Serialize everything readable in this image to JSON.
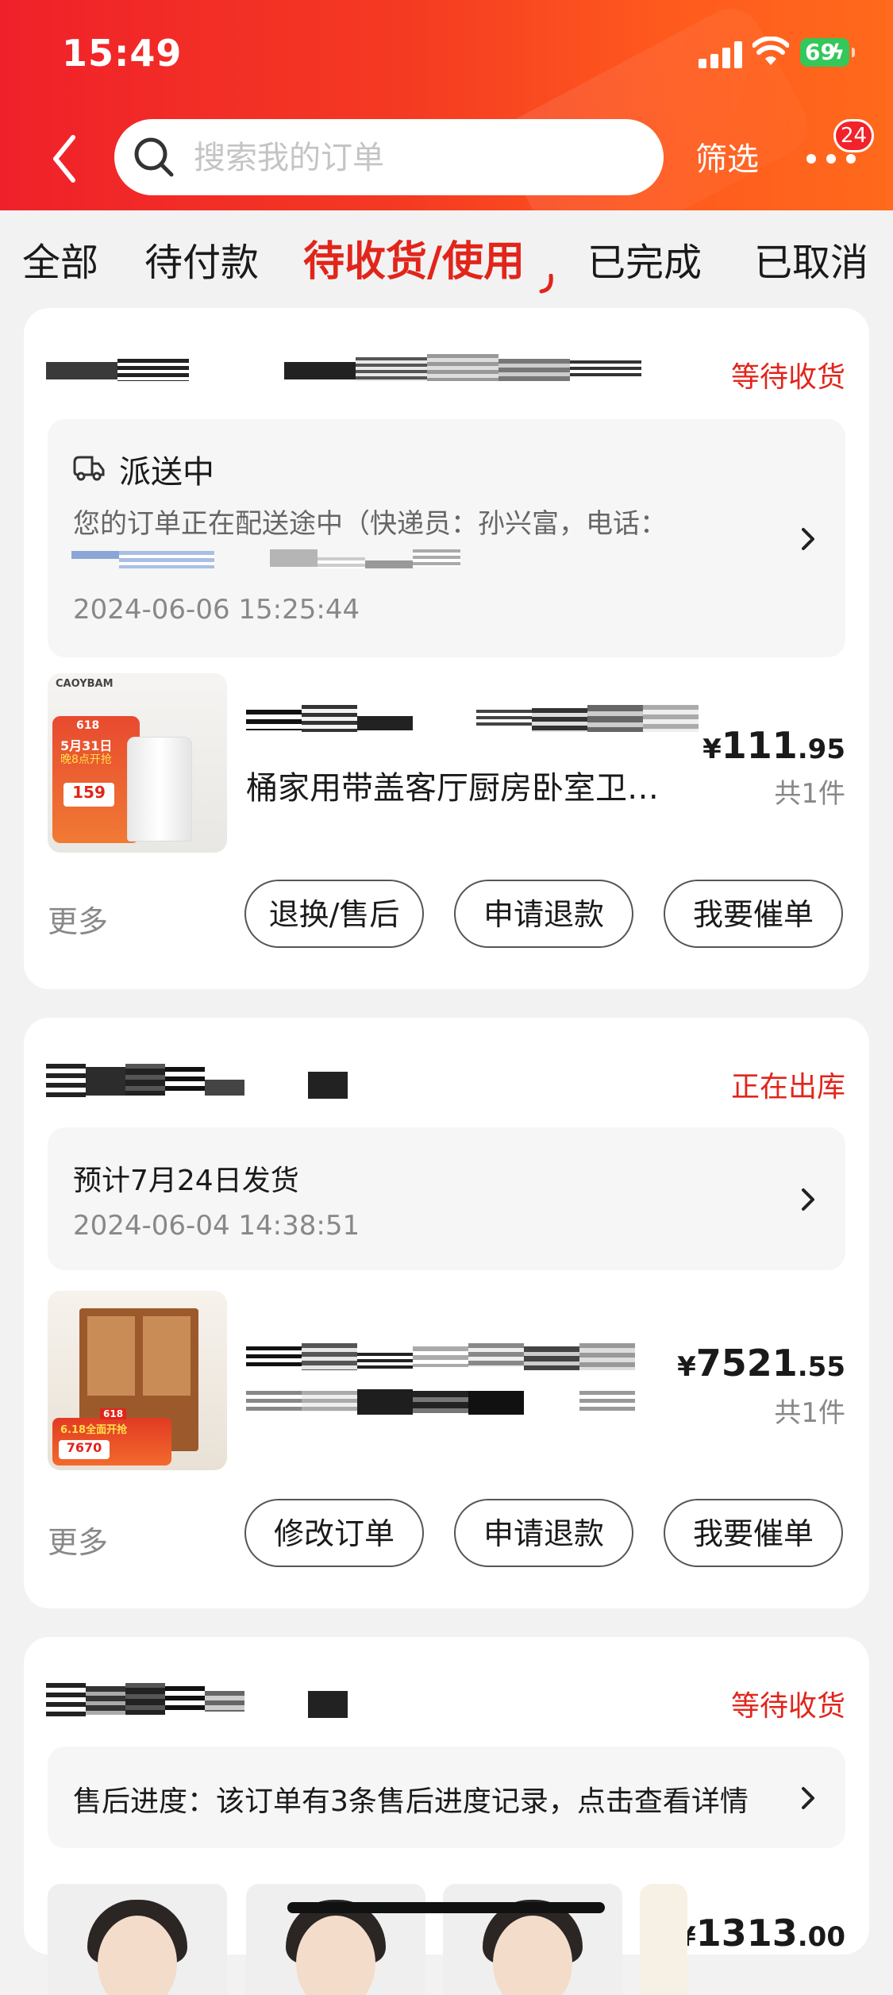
{
  "status_bar": {
    "time": "15:49",
    "battery": "69"
  },
  "header": {
    "search_placeholder": "搜索我的订单",
    "filter_label": "筛选",
    "more_badge": "24"
  },
  "tabs": [
    {
      "label": "全部"
    },
    {
      "label": "待付款"
    },
    {
      "label": "待收货/使用"
    },
    {
      "label": "已完成"
    },
    {
      "label": "已取消"
    }
  ],
  "orders": [
    {
      "status": "等待收货",
      "info_title": "派送中",
      "info_text": "您的订单正在配送途中（快递员：孙兴富，电话：",
      "info_time": "2024-06-06 15:25:44",
      "product_name": "桶家用带盖客厅厨房卧室卫…",
      "price_currency": "¥",
      "price_int": "111",
      "price_dec": ".95",
      "qty": "共1件",
      "more": "更多",
      "buttons": [
        "退换/售后",
        "申请退款",
        "我要催单"
      ],
      "image": {
        "brand": "CAOYBAM",
        "promo_badge": "618",
        "promo_date": "5月31日",
        "promo_time": "晚8点开抢",
        "promo_price": "159"
      }
    },
    {
      "status": "正在出库",
      "info_title": "预计7月24日发货",
      "info_time": "2024-06-04 14:38:51",
      "price_currency": "¥",
      "price_int": "7521",
      "price_dec": ".55",
      "qty": "共1件",
      "more": "更多",
      "buttons": [
        "修改订单",
        "申请退款",
        "我要催单"
      ],
      "image": {
        "promo_badge": "618",
        "promo_text": "6.18全面开抢",
        "promo_price": "7670"
      }
    },
    {
      "status": "等待收货",
      "info_title": "售后进度：该订单有3条售后进度记录，点击查看详情",
      "price_currency": "¥",
      "price_int": "1313",
      "price_dec": ".00"
    }
  ],
  "colors": {
    "accent": "#e1251b",
    "header_start": "#f0202a",
    "header_end": "#ff6a1c",
    "battery": "#34c759"
  },
  "icons": [
    "back-arrow-icon",
    "search-icon",
    "signal-icon",
    "wifi-icon",
    "battery-icon",
    "more-dots-icon",
    "delivery-truck-icon",
    "chevron-right-icon"
  ]
}
